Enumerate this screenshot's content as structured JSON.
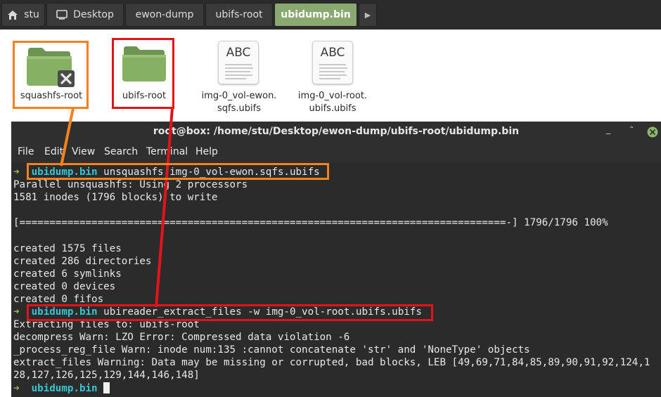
{
  "breadcrumb": {
    "items": [
      {
        "label": "stu"
      },
      {
        "label": "Desktop"
      },
      {
        "label": "ewon-dump"
      },
      {
        "label": "ubifs-root"
      },
      {
        "label": "ubidump.bin"
      }
    ]
  },
  "desktop": {
    "files": [
      {
        "name": "squashfs-root"
      },
      {
        "name": "ubifs-root"
      },
      {
        "name_line1": "img-0_vol-ewon.",
        "name_line2": "sqfs.ubifs",
        "thumb": "ABC"
      },
      {
        "name_line1": "img-0_vol-root.",
        "name_line2": "ubifs.ubifs",
        "thumb": "ABC"
      }
    ]
  },
  "terminal": {
    "title": "root@box: /home/stu/Desktop/ewon-dump/ubifs-root/ubidump.bin",
    "menu": [
      "File",
      "Edit",
      "View",
      "Search",
      "Terminal",
      "Help"
    ],
    "prompt_dir": "ubidump.bin",
    "arrow": "➜",
    "commands": {
      "unsquashfs": "unsquashfs img-0_vol-ewon.sqfs.ubifs",
      "ubireader": "ubireader_extract_files -w img-0_vol-root.ubifs.ubifs"
    },
    "lines": [
      "Parallel unsquashfs: Using 2 processors",
      "1581 inodes (1796 blocks) to write",
      "",
      "[=================================================================================-] 1796/1796 100%",
      "",
      "created 1575 files",
      "created 286 directories",
      "created 6 symlinks",
      "created 0 devices",
      "created 0 fifos",
      "Extracting files to: ubifs-root",
      "decompress Warn: LZO Error: Compressed data violation -6",
      "_process_reg_file Warn: inode num:135 :cannot concatenate 'str' and 'NoneType' objects",
      "extract_files Warning: Data may be missing or corrupted, bad blocks, LEB [49,69,71,84,85,89,90,91,92,124,1",
      "28,127,126,125,129,144,146,148]"
    ]
  },
  "colors": {
    "highlight_orange": "#f5821f",
    "highlight_red": "#e3131c",
    "prompt_cyan": "#34c6d6",
    "prompt_arrow_green": "#8ec14a",
    "active_crumb": "#8aa971",
    "folder_green": "#7fa65f"
  }
}
